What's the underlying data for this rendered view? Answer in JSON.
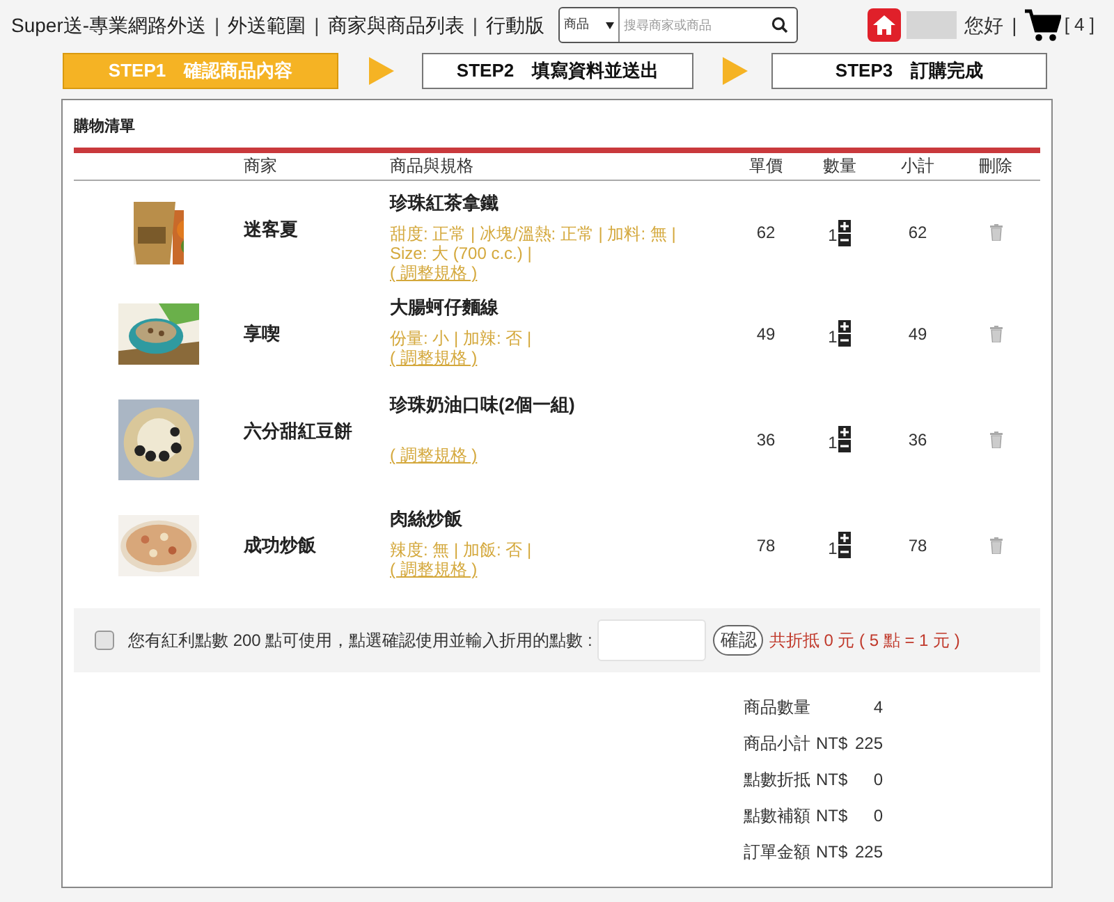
{
  "header": {
    "nav": [
      {
        "kind": "link",
        "text": "Super送-專業網路外送"
      },
      {
        "kind": "separator",
        "text": "|"
      },
      {
        "kind": "link",
        "text": "外送範圍"
      },
      {
        "kind": "separator",
        "text": "|"
      },
      {
        "kind": "link",
        "text": "商家與商品列表"
      },
      {
        "kind": "separator",
        "text": "|"
      },
      {
        "kind": "link",
        "text": "行動版"
      }
    ],
    "search": {
      "category": "商品",
      "placeholder": "搜尋商家或商品"
    },
    "greeting": "您好",
    "separator": "|",
    "cart_count": "[ 4 ]"
  },
  "steps": [
    {
      "label": "STEP1　確認商品內容",
      "selected": true
    },
    {
      "label": "STEP2　填寫資料並送出",
      "selected": false
    },
    {
      "label": "STEP3　訂購完成",
      "selected": false
    }
  ],
  "cart": {
    "title": "購物清單",
    "columns": [
      "商家",
      "商品與規格",
      "單價",
      "數量",
      "小計",
      "刪除"
    ],
    "rows": [
      {
        "merchant": "迷客夏",
        "product": "珍珠紅茶拿鐵",
        "options": "甜度: 正常 | 冰塊/溫熱: 正常 | 加料: 無 | Size: 大 (700 c.c.) |",
        "adjust": "( 調整規格 )",
        "price": "62",
        "quantity": "1",
        "subtotal": "62"
      },
      {
        "merchant": "享喫",
        "product": "大腸蚵仔麵線",
        "options": "份量: 小 | 加辣: 否 |",
        "adjust": "( 調整規格 )",
        "price": "49",
        "quantity": "1",
        "subtotal": "49"
      },
      {
        "merchant": "六分甜紅豆餅",
        "product": "珍珠奶油口味(2個一組)",
        "adjust": "( 調整規格 )",
        "price": "36",
        "quantity": "1",
        "subtotal": "36"
      },
      {
        "merchant": "成功炒飯",
        "product": "肉絲炒飯",
        "options": "辣度: 無 | 加飯: 否 |",
        "adjust": "( 調整規格 )",
        "price": "78",
        "quantity": "1",
        "subtotal": "78"
      }
    ]
  },
  "points": {
    "checked": false,
    "label": "您有紅利點數 200 點可使用，點選確認使用並輸入折用的點數 :",
    "button": "確認",
    "discount": "共折抵 0 元 ( 5 點 = 1 元 )"
  },
  "summary": [
    {
      "label": "商品數量",
      "value": "4"
    },
    {
      "label": "商品小計",
      "currency": "NT$",
      "value": "225"
    },
    {
      "label": "點數折抵",
      "currency": "NT$",
      "value": "0"
    },
    {
      "label": "點數補額",
      "currency": "NT$",
      "value": "0"
    },
    {
      "label": "訂單金額",
      "currency": "NT$",
      "value": "225"
    }
  ]
}
